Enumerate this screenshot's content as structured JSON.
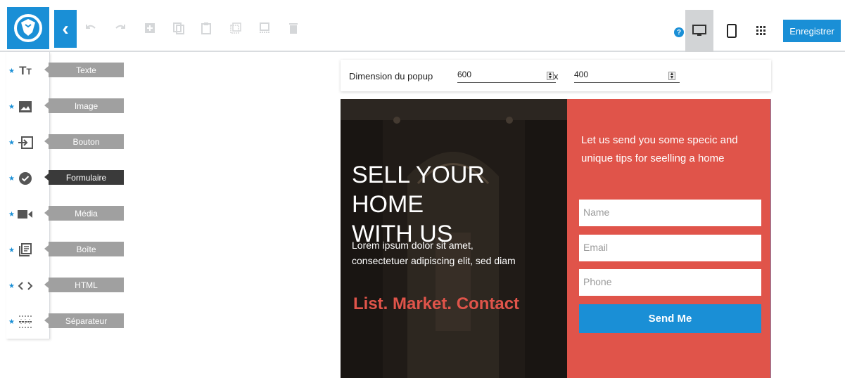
{
  "toolbar": {
    "help_label": "?",
    "save_label": "Enregistrer",
    "tools": [
      "undo-icon",
      "redo-icon",
      "add-icon",
      "copy-icon",
      "paste-icon",
      "duplicate-icon",
      "group-icon",
      "delete-icon"
    ]
  },
  "palette": {
    "items": [
      {
        "label": "Texte",
        "icon": "text-icon"
      },
      {
        "label": "Image",
        "icon": "image-icon"
      },
      {
        "label": "Bouton",
        "icon": "button-icon"
      },
      {
        "label": "Formulaire",
        "icon": "form-check-icon",
        "active": true
      },
      {
        "label": "Média",
        "icon": "video-icon"
      },
      {
        "label": "Boîte",
        "icon": "box-icon"
      },
      {
        "label": "HTML",
        "icon": "code-icon"
      },
      {
        "label": "Séparateur",
        "icon": "separator-icon"
      }
    ]
  },
  "dimension": {
    "label": "Dimension du popup",
    "width": "600",
    "separator": "x",
    "height": "400"
  },
  "popup": {
    "headline_line1": "SELL YOUR HOME",
    "headline_line2": "WITH US",
    "body_line1": "Lorem ipsum dolor sit amet,",
    "body_line2": "consectetuer adipiscing elit, sed diam",
    "tagline": "List. Market. Contact",
    "intro_line1": "Let us send you some specic and",
    "intro_line2": "unique tips for seelling a home",
    "fields": [
      {
        "placeholder": "Name"
      },
      {
        "placeholder": "Email"
      },
      {
        "placeholder": "Phone"
      }
    ],
    "submit_label": "Send Me"
  },
  "colors": {
    "accent": "#1a8fd6",
    "popup_red": "#e0544a",
    "tooltip_gray": "#a0a0a0",
    "tooltip_active": "#3a3a3a"
  }
}
